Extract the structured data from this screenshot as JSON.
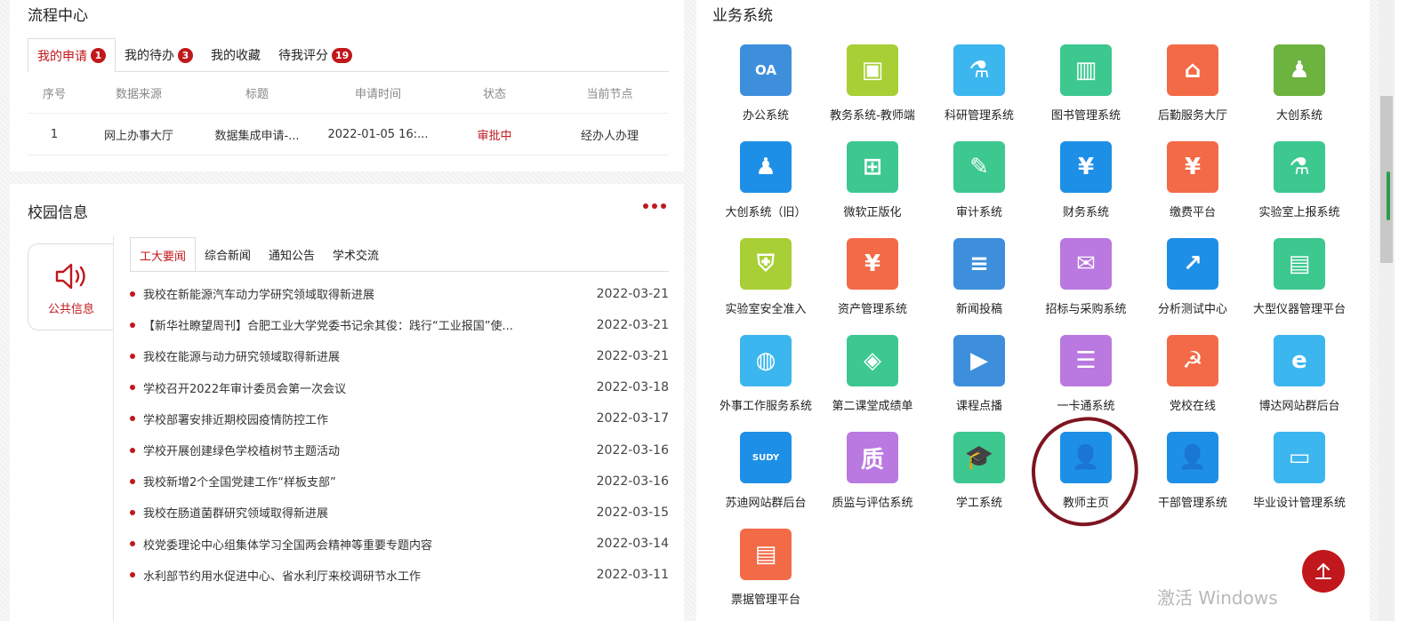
{
  "flow": {
    "title": "流程中心",
    "tabs": [
      {
        "label": "我的申请",
        "badge": "1"
      },
      {
        "label": "我的待办",
        "badge": "3"
      },
      {
        "label": "我的收藏",
        "badge": ""
      },
      {
        "label": "待我评分",
        "badge": "19"
      }
    ],
    "headers": [
      "序号",
      "数据来源",
      "标题",
      "申请时间",
      "状态",
      "当前节点"
    ],
    "rows": [
      {
        "no": "1",
        "source": "网上办事大厅",
        "title": "数据集成申请-...",
        "time": "2022-01-05 16:...",
        "status": "审批中",
        "node": "经办人办理"
      }
    ]
  },
  "campus": {
    "title": "校园信息",
    "side_label": "公共信息",
    "tabs": [
      "工大要闻",
      "综合新闻",
      "通知公告",
      "学术交流"
    ],
    "news": [
      {
        "title": "我校在新能源汽车动力学研究领域取得新进展",
        "date": "2022-03-21"
      },
      {
        "title": "【新华社瞭望周刊】合肥工业大学党委书记余其俊：践行“工业报国”使...",
        "date": "2022-03-21"
      },
      {
        "title": "我校在能源与动力研究领域取得新进展",
        "date": "2022-03-21"
      },
      {
        "title": "学校召开2022年审计委员会第一次会议",
        "date": "2022-03-18"
      },
      {
        "title": "学校部署安排近期校园疫情防控工作",
        "date": "2022-03-17"
      },
      {
        "title": "学校开展创建绿色学校植树节主题活动",
        "date": "2022-03-16"
      },
      {
        "title": "我校新增2个全国党建工作“样板支部”",
        "date": "2022-03-16"
      },
      {
        "title": "我校在肠道菌群研究领域取得新进展",
        "date": "2022-03-15"
      },
      {
        "title": "校党委理论中心组集体学习全国两会精神等重要专题内容",
        "date": "2022-03-14"
      },
      {
        "title": "水利部节约用水促进中心、省水利厅来校调研节水工作",
        "date": "2022-03-11"
      }
    ]
  },
  "biz": {
    "title": "业务系统",
    "apps": [
      {
        "label": "办公系统",
        "color": "#3d8fdc",
        "glyph": "OA"
      },
      {
        "label": "教务系统-教师端",
        "color": "#a8cf35",
        "glyph": "▣"
      },
      {
        "label": "科研管理系统",
        "color": "#3cb6ee",
        "glyph": "⚗"
      },
      {
        "label": "图书管理系统",
        "color": "#3cc88f",
        "glyph": "▥"
      },
      {
        "label": "后勤服务大厅",
        "color": "#f36a47",
        "glyph": "⌂"
      },
      {
        "label": "大创系统",
        "color": "#6db33f",
        "glyph": "♟"
      },
      {
        "label": "大创系统（旧）",
        "color": "#1e8fe6",
        "glyph": "♟"
      },
      {
        "label": "微软正版化",
        "color": "#3cc88f",
        "glyph": "⊞"
      },
      {
        "label": "审计系统",
        "color": "#3cc88f",
        "glyph": "✎"
      },
      {
        "label": "财务系统",
        "color": "#1e8fe6",
        "glyph": "¥"
      },
      {
        "label": "缴费平台",
        "color": "#f36a47",
        "glyph": "¥"
      },
      {
        "label": "实验室上报系统",
        "color": "#3cc88f",
        "glyph": "⚗"
      },
      {
        "label": "实验室安全准入",
        "color": "#a8cf35",
        "glyph": "⛨"
      },
      {
        "label": "资产管理系统",
        "color": "#f36a47",
        "glyph": "¥"
      },
      {
        "label": "新闻投稿",
        "color": "#3d8fdc",
        "glyph": "≡"
      },
      {
        "label": "招标与采购系统",
        "color": "#b979e0",
        "glyph": "✉"
      },
      {
        "label": "分析测试中心",
        "color": "#1e8fe6",
        "glyph": "↗"
      },
      {
        "label": "大型仪器管理平台",
        "color": "#3cc88f",
        "glyph": "▤"
      },
      {
        "label": "外事工作服务系统",
        "color": "#3cb6ee",
        "glyph": "◍"
      },
      {
        "label": "第二课堂成绩单",
        "color": "#3cc88f",
        "glyph": "◈"
      },
      {
        "label": "课程点播",
        "color": "#3d8fdc",
        "glyph": "▶"
      },
      {
        "label": "一卡通系统",
        "color": "#b979e0",
        "glyph": "☰"
      },
      {
        "label": "党校在线",
        "color": "#f36a47",
        "glyph": "☭"
      },
      {
        "label": "博达网站群后台",
        "color": "#3cb6ee",
        "glyph": "e"
      },
      {
        "label": "苏迪网站群后台",
        "color": "#1e8fe6",
        "glyph": "SUDY"
      },
      {
        "label": "质监与评估系统",
        "color": "#b979e0",
        "glyph": "质"
      },
      {
        "label": "学工系统",
        "color": "#3cc88f",
        "glyph": "🎓"
      },
      {
        "label": "教师主页",
        "color": "#1e8fe6",
        "glyph": "👤"
      },
      {
        "label": "干部管理系统",
        "color": "#1e8fe6",
        "glyph": "👤"
      },
      {
        "label": "毕业设计管理系统",
        "color": "#3cb6ee",
        "glyph": "▭"
      },
      {
        "label": "票据管理平台",
        "color": "#f36a47",
        "glyph": "▤"
      }
    ],
    "watermark": "激活 Windows"
  }
}
